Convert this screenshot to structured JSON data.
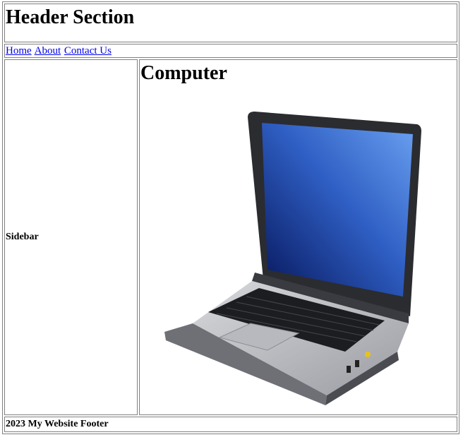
{
  "header": {
    "title": "Header Section"
  },
  "nav": {
    "links": [
      "Home",
      "About",
      "Contact Us"
    ]
  },
  "sidebar": {
    "label": "Sidebar"
  },
  "main": {
    "title": "Computer",
    "image_subject": "laptop computer"
  },
  "footer": {
    "text": "2023 My Website Footer"
  },
  "colors": {
    "link": "#0000ee",
    "border": "#808080",
    "screen_dark": "#0b1f6e",
    "screen_light": "#5a8fe8"
  }
}
